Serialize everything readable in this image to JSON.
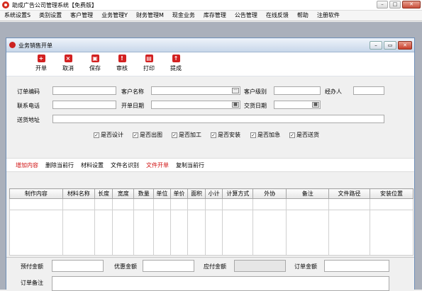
{
  "window": {
    "title": "助成广告公司管理系统【免费版】"
  },
  "menu": [
    "系统设置S",
    "类别设置",
    "客户管理",
    "业务管理Y",
    "财务管理M",
    "现金业务",
    "库存管理",
    "公告管理",
    "在线反馈",
    "帮助",
    "注册软件"
  ],
  "child": {
    "title": "业务销售开单"
  },
  "toolbar": [
    "开单",
    "取消",
    "保存",
    "审核",
    "打印",
    "提成"
  ],
  "form": {
    "order_code": "订单编码",
    "customer_name": "客户名称",
    "customer_level": "客户级别",
    "handler": "经办人",
    "phone": "联系电话",
    "open_date": "开单日期",
    "delivery_date": "交货日期",
    "address": "送货地址"
  },
  "checks": [
    "是否设计",
    "是否出图",
    "是否加工",
    "是否安装",
    "是否加急",
    "是否送货"
  ],
  "actions": [
    "增加内容",
    "删除当前行",
    "材料设置",
    "文件名识别",
    "文件开单",
    "复制当前行"
  ],
  "columns": [
    "制作内容",
    "材料名称",
    "长度",
    "宽度",
    "数量",
    "单位",
    "单价",
    "面积",
    "小计",
    "计算方式",
    "外协",
    "备注",
    "文件路径",
    "安装位置"
  ],
  "footer": {
    "prepaid": "预付金额",
    "discount": "优惠金额",
    "payable": "应付金额",
    "order_amount": "订单金额",
    "order_note": "订单备注"
  }
}
